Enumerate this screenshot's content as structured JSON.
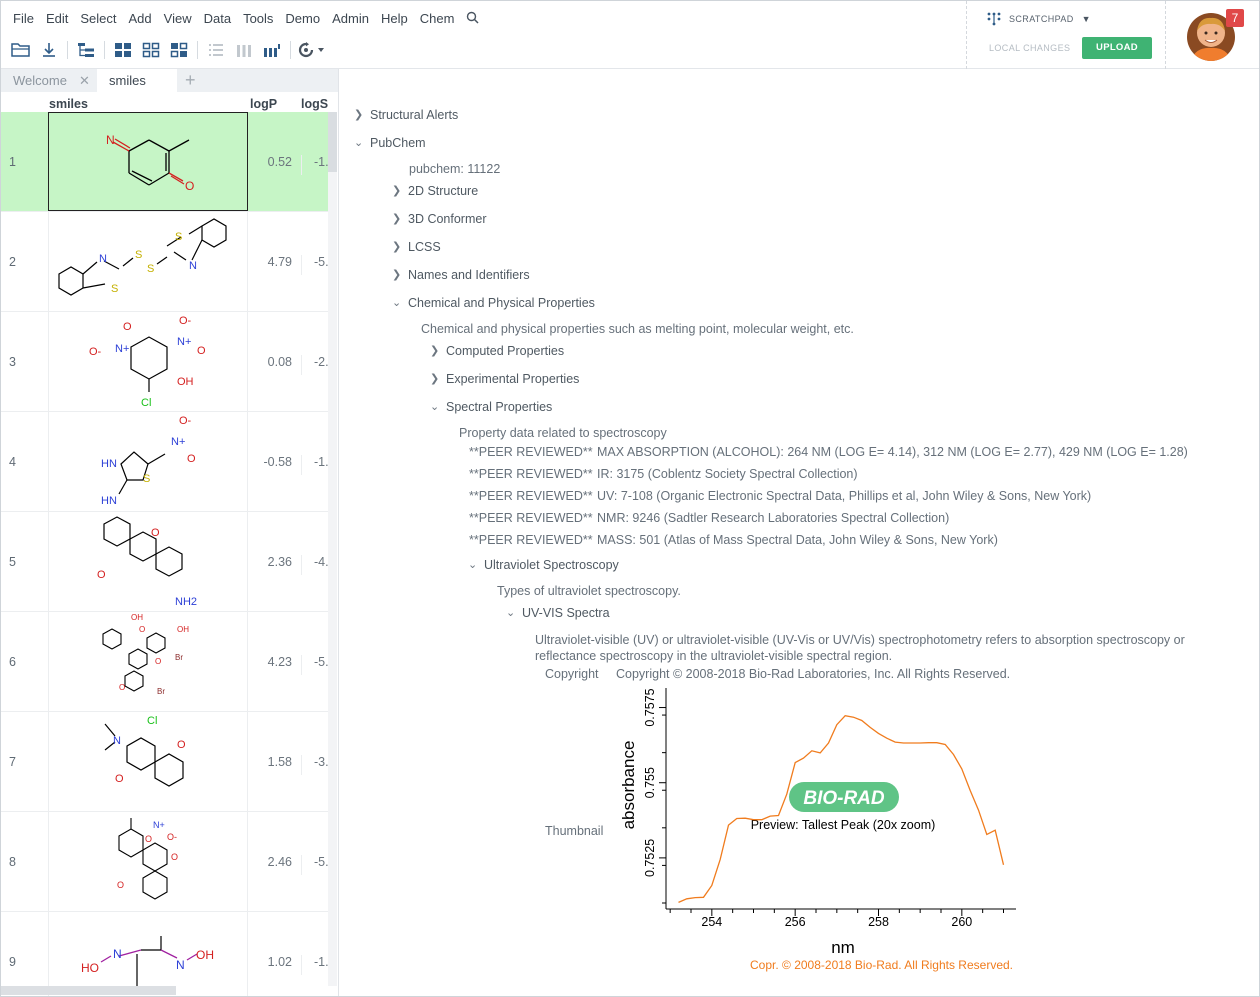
{
  "menu": [
    "File",
    "Edit",
    "Select",
    "Add",
    "View",
    "Data",
    "Tools",
    "Demo",
    "Admin",
    "Help",
    "Chem"
  ],
  "toolbar_icons": [
    "folder-open-icon",
    "download-icon",
    "tree-icon",
    "grid-icon",
    "grid-outline-icon",
    "grid-alt-icon",
    "list-icon",
    "columns-icon",
    "bar-chart-icon",
    "refresh-icon"
  ],
  "scratchpad": {
    "label": "SCRATCHPAD",
    "local_changes": "LOCAL CHANGES",
    "upload": "UPLOAD"
  },
  "user": {
    "notification_count": "7"
  },
  "tabs": [
    {
      "label": "Welcome",
      "close": "✕"
    },
    {
      "label": "smiles"
    },
    {
      "label": "+"
    }
  ],
  "grid": {
    "columns": [
      "smiles",
      "logP",
      "logS"
    ],
    "rows": [
      {
        "num": "1",
        "logP": "0.52",
        "logS": "-1."
      },
      {
        "num": "2",
        "logP": "4.79",
        "logS": "-5."
      },
      {
        "num": "3",
        "logP": "0.08",
        "logS": "-2."
      },
      {
        "num": "4",
        "logP": "-0.58",
        "logS": "-1."
      },
      {
        "num": "5",
        "logP": "2.36",
        "logS": "-4."
      },
      {
        "num": "6",
        "logP": "4.23",
        "logS": "-5."
      },
      {
        "num": "7",
        "logP": "1.58",
        "logS": "-3."
      },
      {
        "num": "8",
        "logP": "2.46",
        "logS": "-5."
      },
      {
        "num": "9",
        "logP": "1.02",
        "logS": "-1."
      }
    ],
    "atom_labels": {
      "r2": [
        "N",
        "S",
        "S",
        "S",
        "S",
        "N"
      ],
      "r3": [
        "O",
        "N+",
        "O-",
        "O-",
        "N+",
        "O",
        "OH",
        "Cl"
      ],
      "r4": [
        "O-",
        "N+",
        "O",
        "HN",
        "S",
        "HN"
      ],
      "r5": [
        "O",
        "O",
        "NH2"
      ],
      "r6": [
        "OH",
        "O",
        "OH",
        "O",
        "Br",
        "O",
        "Br"
      ],
      "r7": [
        "Cl",
        "N",
        "O",
        "O"
      ],
      "r8": [
        "N+",
        "O-",
        "O",
        "O",
        "O"
      ],
      "r9": [
        "HO",
        "N",
        "N",
        "OH"
      ]
    }
  },
  "tree": {
    "structural_alerts": "Structural Alerts",
    "pubchem": "PubChem",
    "pubchem_id": "pubchem: 11122",
    "structure_2d": "2D Structure",
    "conformer_3d": "3D Conformer",
    "lcss": "LCSS",
    "names": "Names and Identifiers",
    "chem_phys": "Chemical and Physical Properties",
    "chem_phys_desc": "Chemical and physical properties such as melting point, molecular weight, etc.",
    "computed": "Computed Properties",
    "experimental": "Experimental Properties",
    "spectral": "Spectral Properties",
    "spectral_desc": "Property data related to spectroscopy",
    "peer_reviewed": [
      {
        "key": "**PEER REVIEWED**",
        "value": "MAX ABSORPTION (ALCOHOL): 264 NM (LOG E= 4.14), 312 NM (LOG E= 2.77), 429 NM (LOG E= 1.28)"
      },
      {
        "key": "**PEER REVIEWED**",
        "value": "IR: 3175 (Coblentz Society Spectral Collection)"
      },
      {
        "key": "**PEER REVIEWED**",
        "value": "UV: 7-108 (Organic Electronic Spectral Data, Phillips et al, John Wiley & Sons, New York)"
      },
      {
        "key": "**PEER REVIEWED**",
        "value": "NMR: 9246 (Sadtler Research Laboratories Spectral Collection)"
      },
      {
        "key": "**PEER REVIEWED**",
        "value": "MASS: 501 (Atlas of Mass Spectral Data, John Wiley & Sons, New York)"
      }
    ],
    "uv_spec": "Ultraviolet Spectroscopy",
    "uv_spec_desc": "Types of ultraviolet spectroscopy.",
    "uv_vis": "UV-VIS Spectra",
    "uv_vis_desc": "Ultraviolet-visible (UV) or ultraviolet-visible (UV-Vis or UV/Vis) spectrophotometry refers to absorption spectroscopy or reflectance spectroscopy in the ultraviolet-visible spectral region.",
    "copyright_key": "Copyright",
    "copyright_value": "Copyright © 2008-2018 Bio-Rad Laboratories, Inc. All Rights Reserved.",
    "thumbnail_key": "Thumbnail"
  },
  "chart_data": {
    "type": "line",
    "xlabel": "nm",
    "ylabel": "absorbance",
    "xlim": [
      252.9,
      261.3
    ],
    "ylim": [
      7.508,
      7.5815
    ],
    "xticks": [
      "254",
      "256",
      "258",
      "260"
    ],
    "yticks": [
      "0.7525",
      "0.755",
      "0.7575"
    ],
    "logo_text": "BIO-RAD",
    "preview_label": "Preview: Tallest Peak (20x zoom)",
    "copyright": "Copr. © 2008-2018 Bio-Rad.  All Rights Reserved.",
    "line_color": "#f07c1e",
    "x": [
      253.2,
      253.4,
      253.6,
      253.8,
      254.0,
      254.2,
      254.4,
      254.6,
      254.8,
      255.0,
      255.2,
      255.4,
      255.6,
      255.8,
      256.0,
      256.2,
      256.4,
      256.6,
      256.8,
      257.0,
      257.2,
      257.4,
      257.6,
      257.8,
      258.0,
      258.2,
      258.4,
      258.6,
      258.8,
      259.0,
      259.2,
      259.4,
      259.6,
      259.8,
      260.0,
      260.2,
      260.4,
      260.6,
      260.8,
      261.0
    ],
    "y": [
      7.5102,
      7.5114,
      7.5118,
      7.5119,
      7.5158,
      7.5245,
      7.5359,
      7.5381,
      7.5382,
      7.5377,
      7.5377,
      7.5389,
      7.5391,
      7.5462,
      7.5567,
      7.5582,
      7.5606,
      7.5599,
      7.5632,
      7.5693,
      7.5723,
      7.5718,
      7.5707,
      7.5684,
      7.5664,
      7.5648,
      7.5635,
      7.5632,
      7.5632,
      7.5632,
      7.5633,
      7.5633,
      7.5627,
      7.5594,
      7.5546,
      7.5474,
      7.5409,
      7.5328,
      7.5342,
      7.5227
    ]
  }
}
